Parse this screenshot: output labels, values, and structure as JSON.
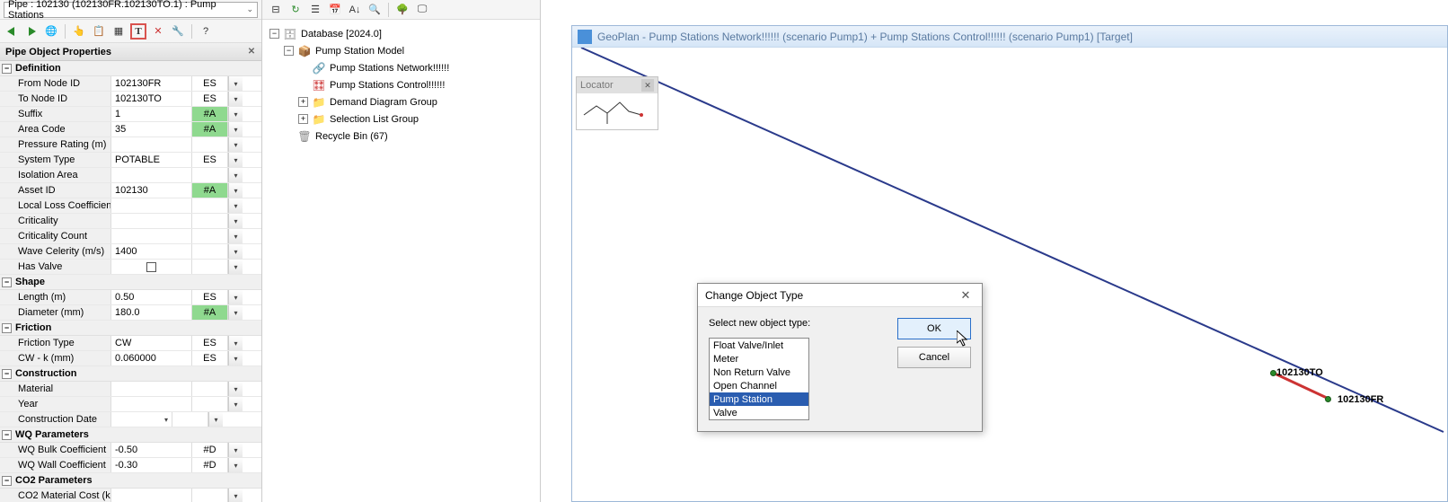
{
  "selector_text": "Pipe : 102130 (102130FR.102130TO.1) : Pump Stations",
  "panel_title": "Pipe Object Properties",
  "groups": [
    {
      "label": "Definition",
      "rows": [
        {
          "label": "From Node ID",
          "val": "102130FR",
          "flag": "ES",
          "flagcls": ""
        },
        {
          "label": "To Node ID",
          "val": "102130TO",
          "flag": "ES",
          "flagcls": ""
        },
        {
          "label": "Suffix",
          "val": "1",
          "flag": "#A",
          "flagcls": "flag-green"
        },
        {
          "label": "Area Code",
          "val": "35",
          "flag": "#A",
          "flagcls": "flag-green"
        },
        {
          "label": "Pressure Rating (m)",
          "val": "",
          "flag": "",
          "flagcls": ""
        },
        {
          "label": "System Type",
          "val": "POTABLE",
          "flag": "ES",
          "flagcls": ""
        },
        {
          "label": "Isolation Area",
          "val": "",
          "flag": "",
          "flagcls": ""
        },
        {
          "label": "Asset ID",
          "val": "102130",
          "flag": "#A",
          "flagcls": "flag-green"
        },
        {
          "label": "Local Loss Coefficien",
          "val": "",
          "flag": "",
          "flagcls": ""
        },
        {
          "label": "Criticality",
          "val": "",
          "flag": "",
          "flagcls": ""
        },
        {
          "label": "Criticality Count",
          "val": "",
          "flag": "",
          "flagcls": ""
        },
        {
          "label": "Wave Celerity (m/s)",
          "val": "1400",
          "flag": "",
          "flagcls": ""
        },
        {
          "label": "Has Valve",
          "val": "",
          "flag": "",
          "flagcls": "",
          "checkbox": true
        }
      ]
    },
    {
      "label": "Shape",
      "rows": [
        {
          "label": "Length (m)",
          "val": "0.50",
          "flag": "ES",
          "flagcls": ""
        },
        {
          "label": "Diameter (mm)",
          "val": "180.0",
          "flag": "#A",
          "flagcls": "flag-green"
        }
      ]
    },
    {
      "label": "Friction",
      "rows": [
        {
          "label": "Friction Type",
          "val": "CW",
          "flag": "ES",
          "flagcls": ""
        },
        {
          "label": "CW - k (mm)",
          "val": "0.060000",
          "flag": "ES",
          "flagcls": ""
        }
      ]
    },
    {
      "label": "Construction",
      "rows": [
        {
          "label": "Material",
          "val": "",
          "flag": "",
          "flagcls": ""
        },
        {
          "label": "Year",
          "val": "",
          "flag": "",
          "flagcls": ""
        },
        {
          "label": "Construction Date",
          "val": "",
          "flag": "",
          "flagcls": "",
          "date": true
        }
      ]
    },
    {
      "label": "WQ Parameters",
      "rows": [
        {
          "label": "WQ Bulk Coefficient",
          "val": "-0.50",
          "flag": "#D",
          "flagcls": ""
        },
        {
          "label": "WQ Wall Coefficient",
          "val": "-0.30",
          "flag": "#D",
          "flagcls": ""
        }
      ]
    },
    {
      "label": "CO2 Parameters",
      "rows": [
        {
          "label": "CO2 Material Cost (k",
          "val": "",
          "flag": "",
          "flagcls": ""
        }
      ]
    }
  ],
  "tree": [
    {
      "indent": 0,
      "exp": "-",
      "icon": "db",
      "label": "Database [2024.0]"
    },
    {
      "indent": 1,
      "exp": "-",
      "icon": "model",
      "label": "Pump Station Model"
    },
    {
      "indent": 2,
      "exp": "",
      "icon": "net",
      "label": "Pump Stations Network!!!!!!"
    },
    {
      "indent": 2,
      "exp": "",
      "icon": "ctrl",
      "label": "Pump Stations Control!!!!!!"
    },
    {
      "indent": 2,
      "exp": "+",
      "icon": "folder",
      "label": "Demand Diagram Group"
    },
    {
      "indent": 2,
      "exp": "+",
      "icon": "folder",
      "label": "Selection List Group"
    },
    {
      "indent": 1,
      "exp": "",
      "icon": "bin",
      "label": "Recycle Bin (67)"
    }
  ],
  "geoplan_title": "GeoPlan - Pump Stations Network!!!!!! (scenario Pump1)  + Pump Stations Control!!!!!! (scenario Pump1)  [Target]",
  "locator_title": "Locator",
  "node_labels": {
    "to": "102130TO",
    "fr": "102130FR"
  },
  "dialog": {
    "title": "Change Object Type",
    "prompt": "Select new object type:",
    "ok": "OK",
    "cancel": "Cancel",
    "items": [
      "Float Valve/Inlet",
      "Meter",
      "Non Return Valve",
      "Open Channel",
      "Pump Station",
      "Valve"
    ],
    "selected": "Pump Station"
  }
}
